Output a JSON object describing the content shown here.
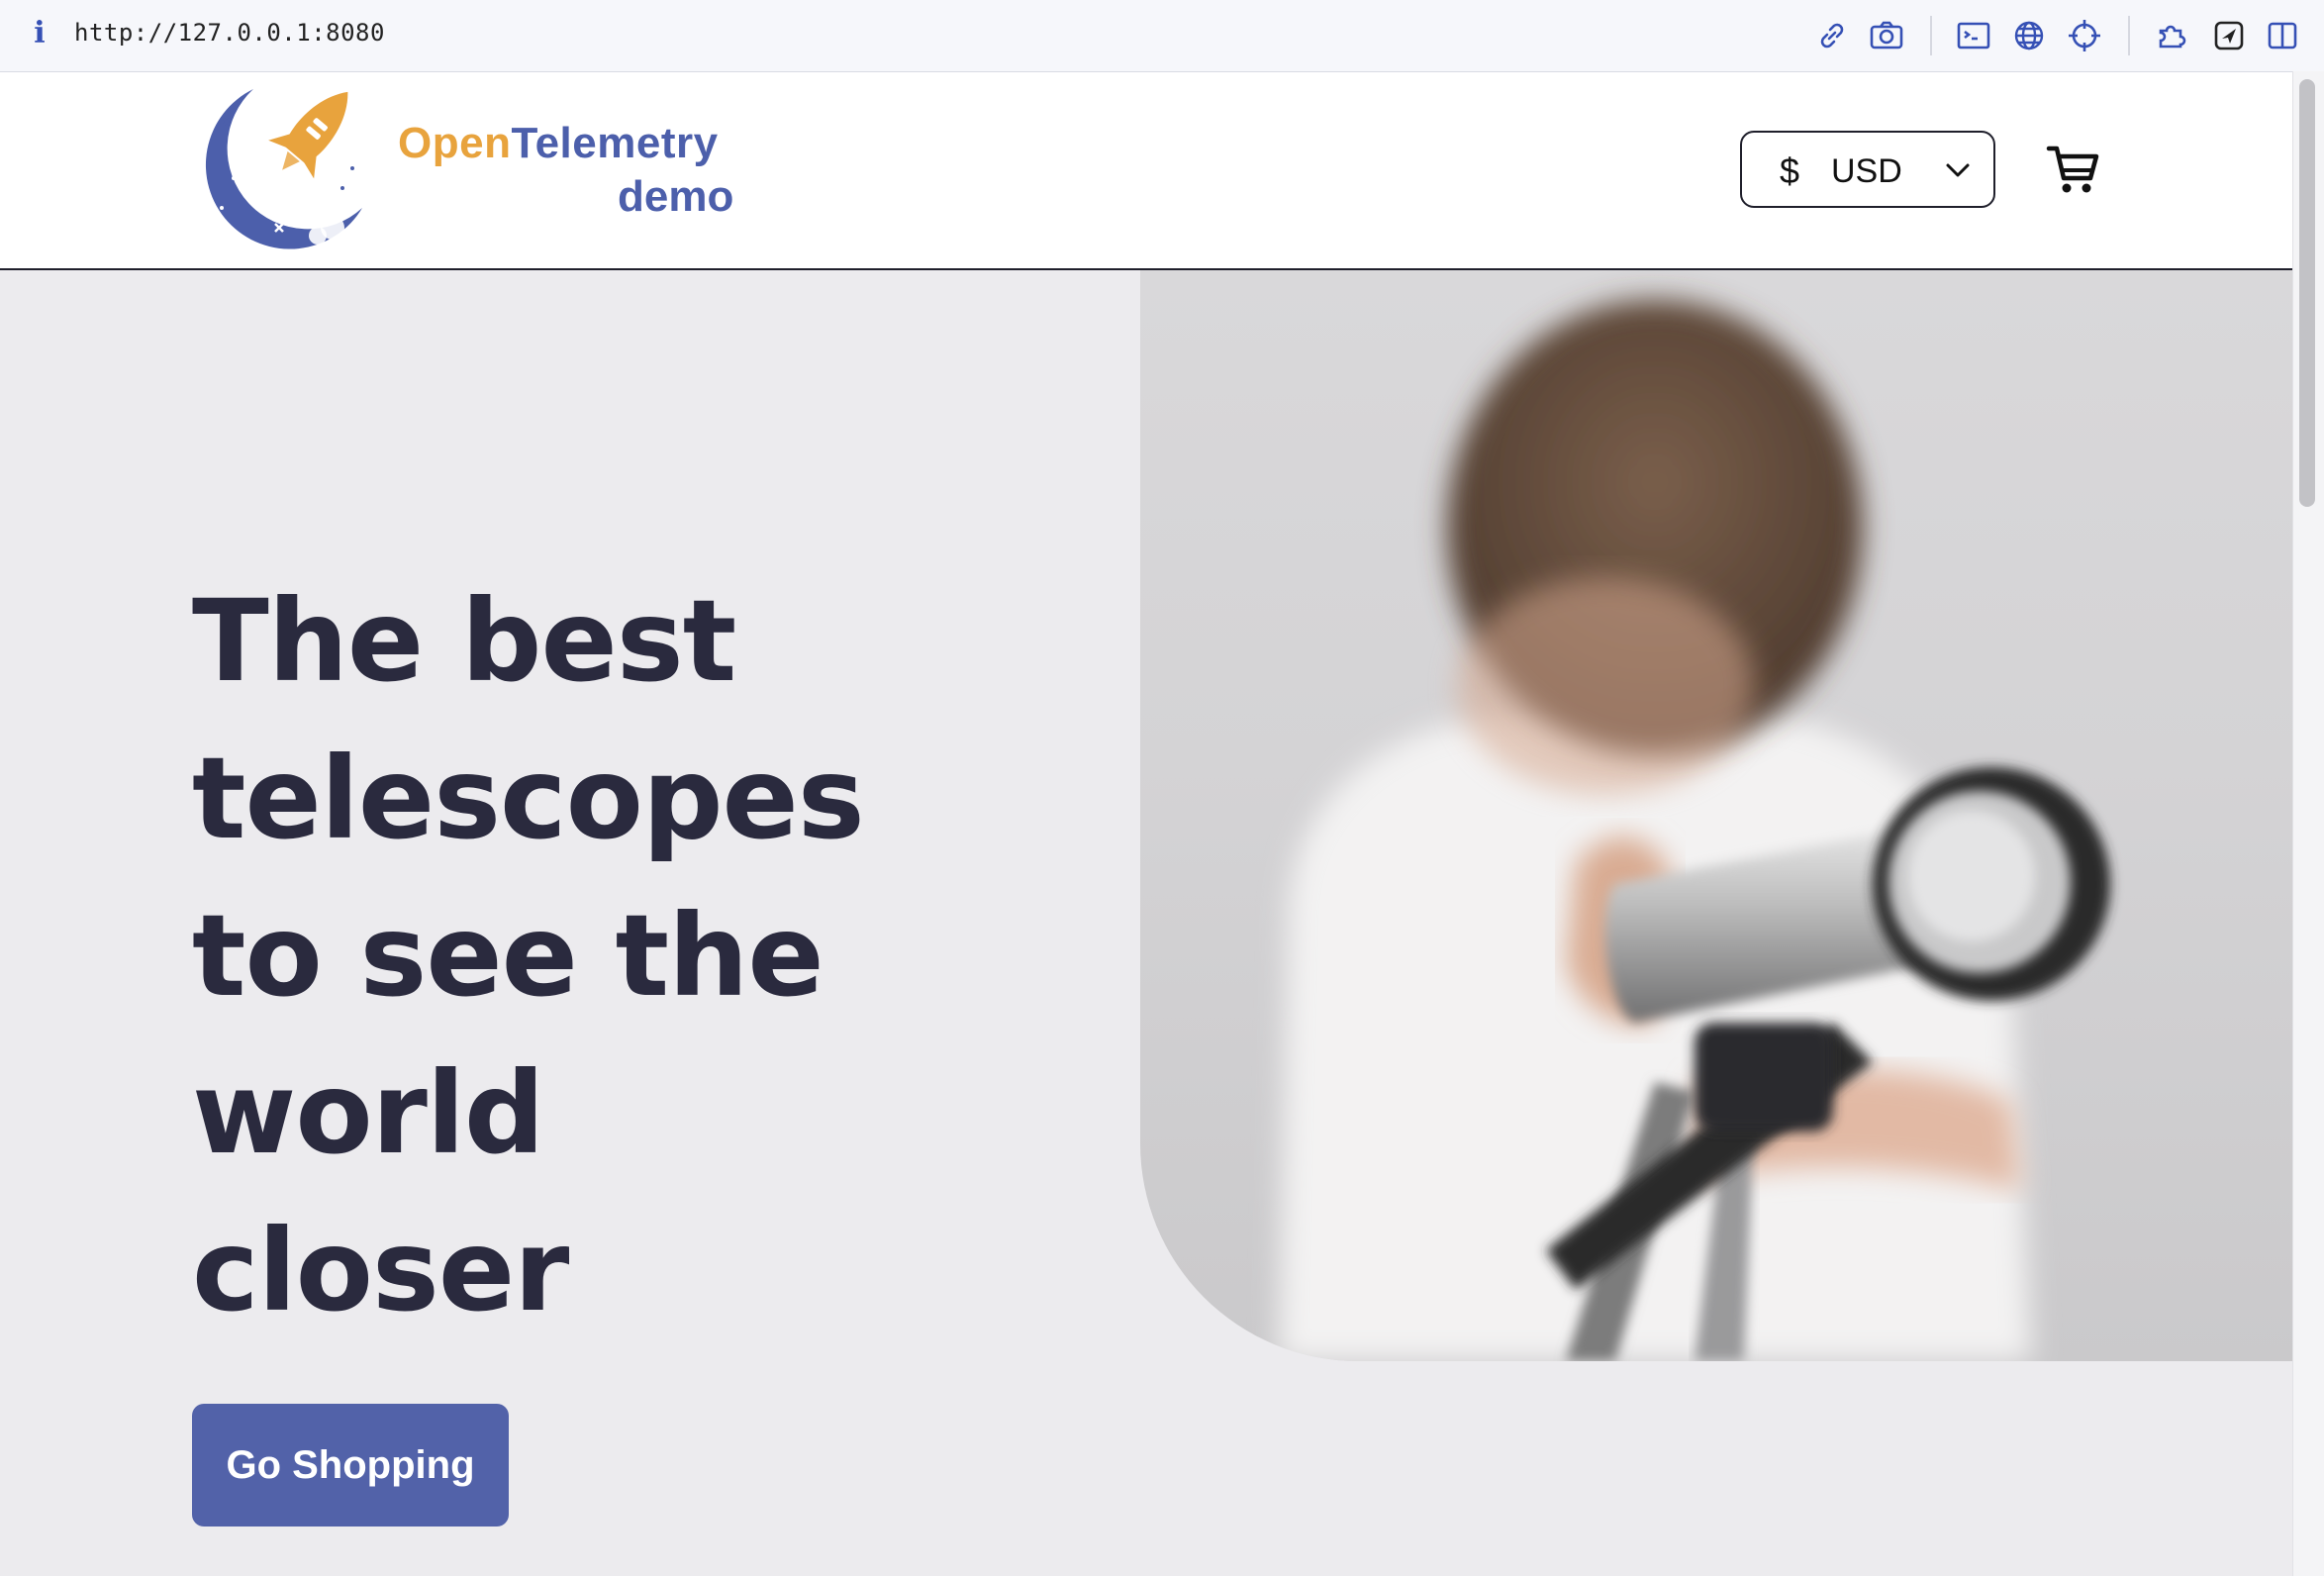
{
  "browser": {
    "url": "http://127.0.0.1:8080",
    "info_glyph": "i",
    "toolbar_icons": [
      "link-icon",
      "camera-icon",
      "terminal-icon",
      "globe-icon",
      "crosshair-icon",
      "extensions-icon",
      "send-icon",
      "sidebar-icon"
    ]
  },
  "header": {
    "logo_text_open": "Open",
    "logo_text_telemetry": "Telemetry",
    "logo_text_demo": "demo",
    "currency_symbol": "$",
    "currency_code": "USD"
  },
  "hero": {
    "title_lines": [
      "The best",
      "telescopes",
      "to see the",
      "world",
      "closer"
    ],
    "button_label": "Go Shopping"
  },
  "colors": {
    "accent": "#5262a9",
    "logo_orange": "#e8a33d",
    "logo_blue": "#4c5fab",
    "title": "#2a2a3e",
    "background": "#ecebee"
  }
}
